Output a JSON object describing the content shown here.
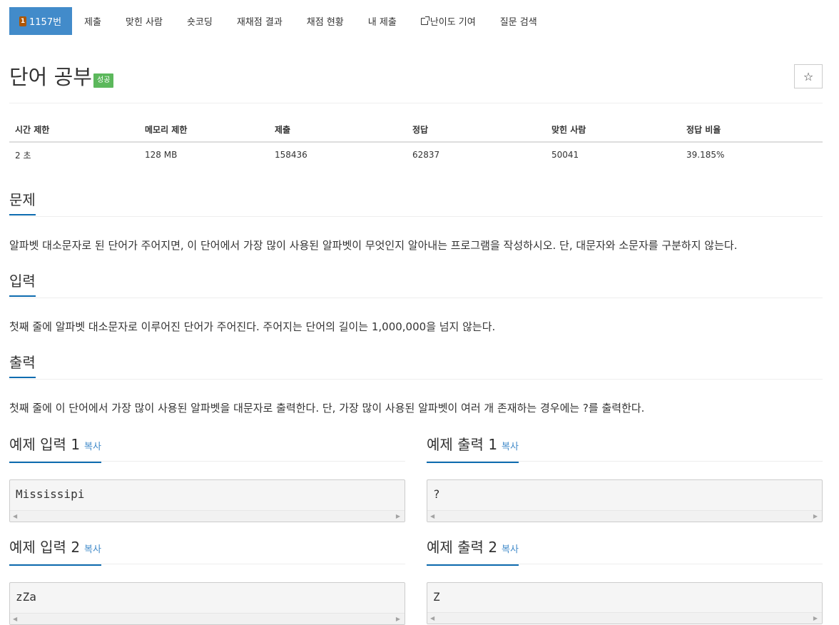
{
  "tabs": [
    {
      "label": "1157번",
      "active": true
    },
    {
      "label": "제출"
    },
    {
      "label": "맞힌 사람"
    },
    {
      "label": "숏코딩"
    },
    {
      "label": "재채점 결과"
    },
    {
      "label": "채점 현황"
    },
    {
      "label": "내 제출"
    },
    {
      "label": "난이도 기여",
      "icon": "external-link-icon"
    },
    {
      "label": "질문 검색"
    }
  ],
  "problem": {
    "title": "단어 공부",
    "badge": "성공",
    "star": "☆"
  },
  "info_table": {
    "headers": [
      "시간 제한",
      "메모리 제한",
      "제출",
      "정답",
      "맞힌 사람",
      "정답 비율"
    ],
    "values": [
      "2 초",
      "128 MB",
      "158436",
      "62837",
      "50041",
      "39.185%"
    ]
  },
  "sections": {
    "problem_label": "문제",
    "problem_text": "알파벳 대소문자로 된 단어가 주어지면, 이 단어에서 가장 많이 사용된 알파벳이 무엇인지 알아내는 프로그램을 작성하시오. 단, 대문자와 소문자를 구분하지 않는다.",
    "input_label": "입력",
    "input_text": "첫째 줄에 알파벳 대소문자로 이루어진 단어가 주어진다. 주어지는 단어의 길이는 1,000,000을 넘지 않는다.",
    "output_label": "출력",
    "output_text": "첫째 줄에 이 단어에서 가장 많이 사용된 알파벳을 대문자로 출력한다. 단, 가장 많이 사용된 알파벳이 여러 개 존재하는 경우에는 ?를 출력한다."
  },
  "samples": [
    {
      "in_label": "예제 입력 1",
      "out_label": "예제 출력 1",
      "input": "Mississipi",
      "output": "?"
    },
    {
      "in_label": "예제 입력 2",
      "out_label": "예제 출력 2",
      "input": "zZa",
      "output": "Z"
    }
  ],
  "copy_label": "복사",
  "colors": {
    "active_tab": "#428bca",
    "badge": "#5cb85c",
    "section_underline": "#0e6cb0",
    "tier_bronze": "#ad5600"
  }
}
